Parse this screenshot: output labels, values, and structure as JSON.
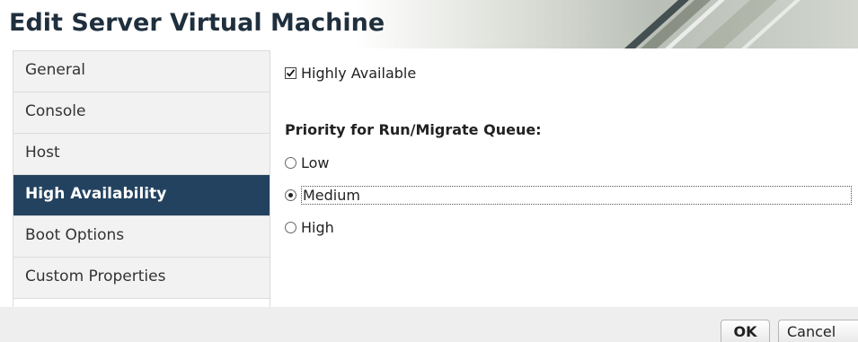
{
  "dialog": {
    "title": "Edit Server Virtual Machine"
  },
  "sidebar": {
    "items": [
      {
        "label": "General",
        "active": false
      },
      {
        "label": "Console",
        "active": false
      },
      {
        "label": "Host",
        "active": false
      },
      {
        "label": "High Availability",
        "active": true
      },
      {
        "label": "Boot Options",
        "active": false
      },
      {
        "label": "Custom Properties",
        "active": false
      }
    ]
  },
  "content": {
    "highly_available": {
      "label": "Highly Available",
      "checked": true
    },
    "priority_heading": "Priority for Run/Migrate Queue:",
    "priority_options": [
      {
        "label": "Low",
        "selected": false
      },
      {
        "label": "Medium",
        "selected": true
      },
      {
        "label": "High",
        "selected": false
      }
    ]
  },
  "footer": {
    "ok_label": "OK",
    "cancel_label": "Cancel"
  },
  "colors": {
    "active_nav_bg": "#23425f",
    "title_text": "#1f2f3d"
  }
}
